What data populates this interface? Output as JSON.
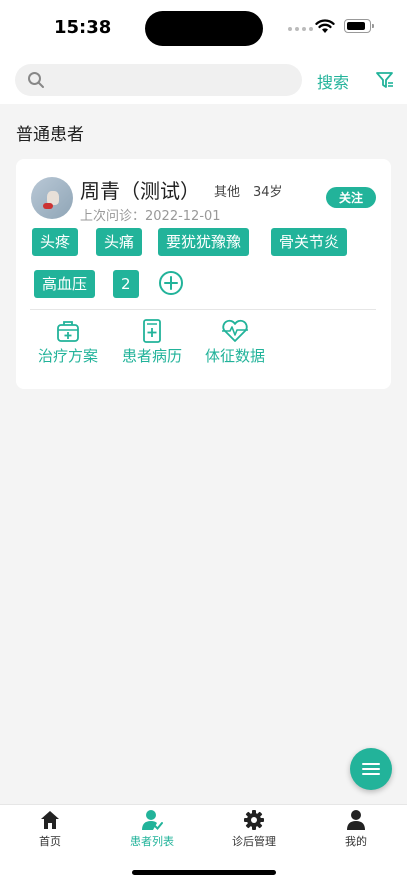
{
  "status_bar": {
    "time": "15:38"
  },
  "search": {
    "placeholder": "",
    "button_label": "搜索"
  },
  "section_title": "普通患者",
  "patient": {
    "name": "周青（测试）",
    "gender": "其他",
    "age": "34岁",
    "last_visit": "上次问诊：2022-12-01",
    "follow_label": "关注",
    "tags": [
      "头疼",
      "头痛",
      "要犹犹豫豫",
      "骨关节炎",
      "高血压",
      "2"
    ],
    "actions": [
      {
        "label": "治疗方案",
        "icon": "medical-kit-icon"
      },
      {
        "label": "患者病历",
        "icon": "medical-record-icon"
      },
      {
        "label": "体征数据",
        "icon": "heartbeat-icon"
      }
    ]
  },
  "tab_bar": {
    "tabs": [
      {
        "label": "首页",
        "icon": "home-icon"
      },
      {
        "label": "患者列表",
        "icon": "patients-icon"
      },
      {
        "label": "诊后管理",
        "icon": "gear-icon"
      },
      {
        "label": "我的",
        "icon": "user-icon"
      }
    ],
    "active_index": 1
  },
  "colors": {
    "accent": "#22b39a",
    "background": "#f4f4f4",
    "card": "#ffffff"
  }
}
